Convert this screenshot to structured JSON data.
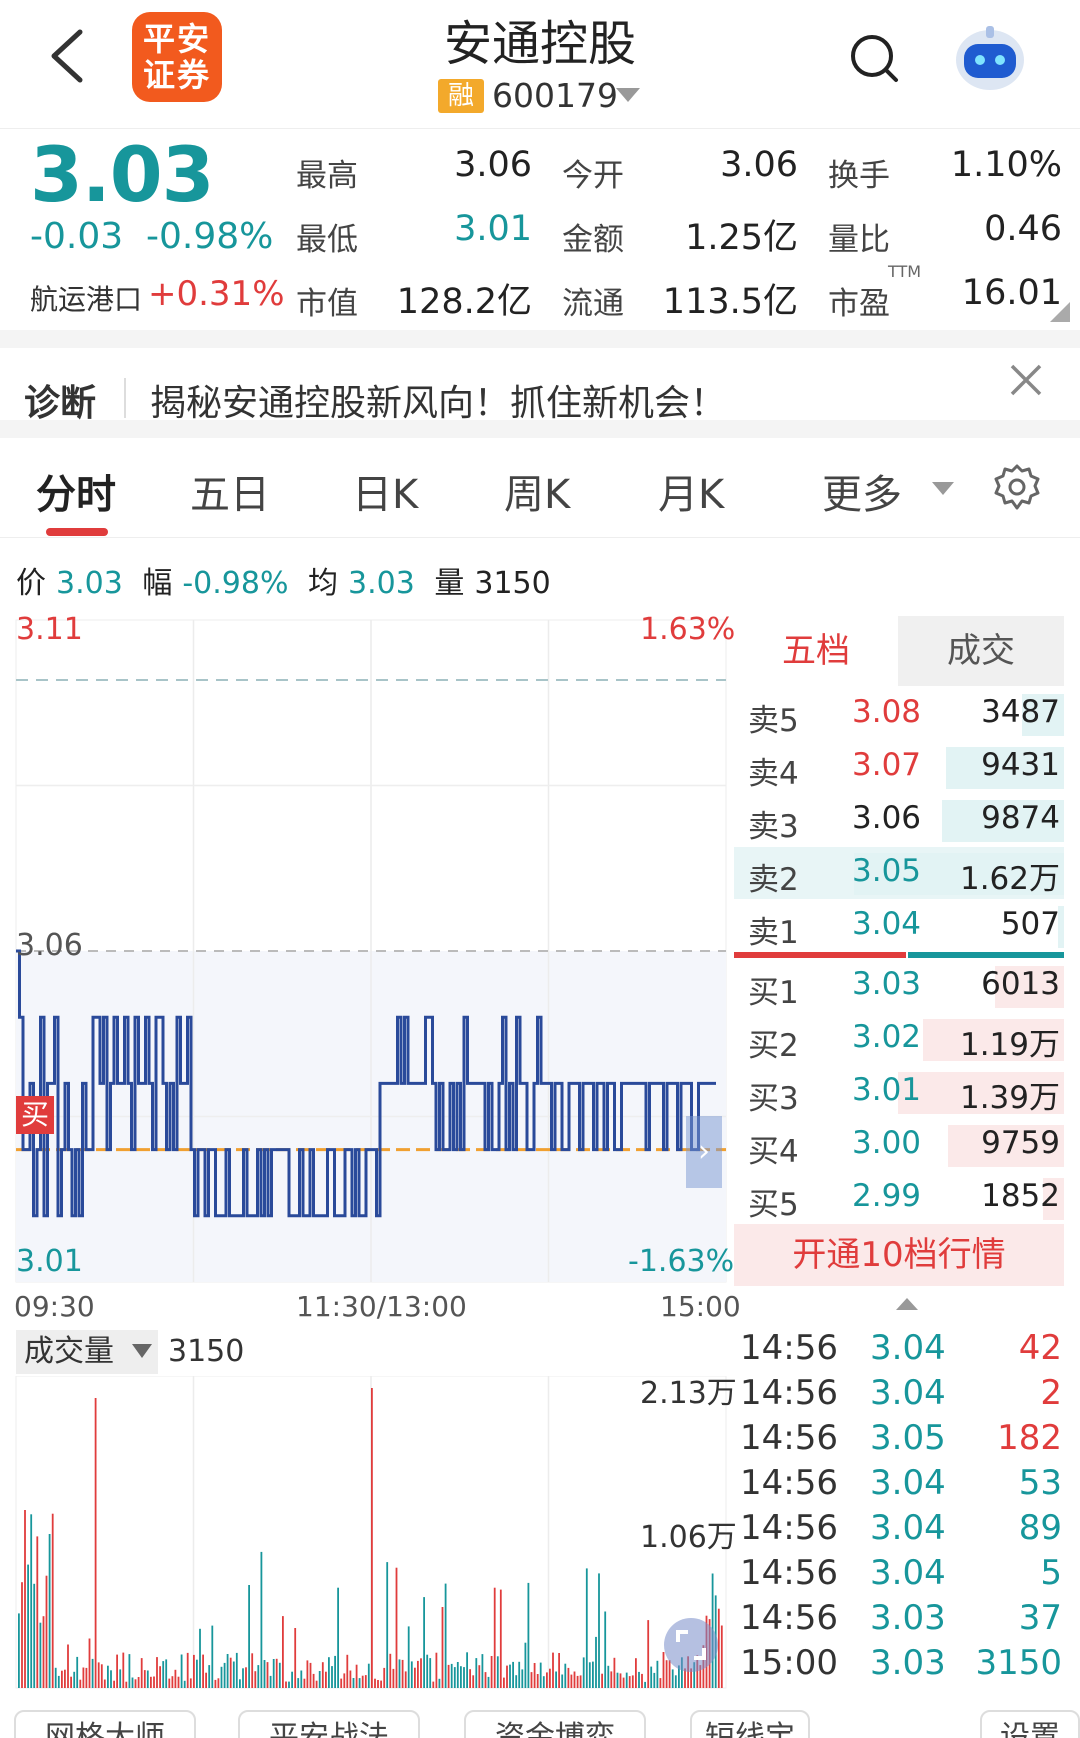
{
  "header": {
    "logo_line1": "平安",
    "logo_line2": "证券",
    "stock_name": "安通控股",
    "badge": "融",
    "stock_code": "600179"
  },
  "quote": {
    "price": "3.03",
    "change": "-0.03",
    "change_pct": "-0.98%",
    "sector_label": "航运港口",
    "sector_change": "+0.31%",
    "items": [
      {
        "label": "最高",
        "value": "3.06"
      },
      {
        "label": "今开",
        "value": "3.06"
      },
      {
        "label": "换手",
        "value": "1.10%"
      },
      {
        "label": "最低",
        "value": "3.01"
      },
      {
        "label": "金额",
        "value": "1.25亿"
      },
      {
        "label": "量比",
        "value": "0.46"
      },
      {
        "label": "市值",
        "value": "128.2亿"
      },
      {
        "label": "流通",
        "value": "113.5亿"
      },
      {
        "label": "市盈",
        "value": "16.01"
      }
    ],
    "ttm": "TTM"
  },
  "diagnosis": {
    "title": "诊断",
    "text": "揭秘安通控股新风向！抓住新机会！"
  },
  "tabs": [
    "分时",
    "五日",
    "日K",
    "周K",
    "月K",
    "更多"
  ],
  "info_row": {
    "price_label": "价",
    "price": "3.03",
    "range_label": "幅",
    "range": "-0.98%",
    "avg_label": "均",
    "avg": "3.03",
    "vol_label": "量",
    "vol": "3150"
  },
  "chart": {
    "y_max": "3.11",
    "y_max_pct": "1.63%",
    "y_ref": "3.06",
    "y_min": "3.01",
    "y_min_pct": "-1.63%",
    "x_start": "09:30",
    "x_mid": "11:30/13:00",
    "x_end": "15:00",
    "buy_marker": "买",
    "colors": {
      "line": "#2a4a9a",
      "avg": "#f0a030",
      "up": "#e03c3c",
      "down": "#17969b"
    }
  },
  "chart_data": {
    "type": "line",
    "ylim": [
      3.01,
      3.11
    ],
    "price_levels": [
      3.06,
      3.05,
      3.04,
      3.03,
      3.02
    ],
    "prev_close": 3.06,
    "avg_price": 3.03
  },
  "order_book": {
    "tab_five": "五档",
    "tab_deals": "成交",
    "asks": [
      {
        "label": "卖5",
        "price": "3.08",
        "vol": "3487",
        "bar": 0.2
      },
      {
        "label": "卖4",
        "price": "3.07",
        "vol": "9431",
        "bar": 0.56
      },
      {
        "label": "卖3",
        "price": "3.06",
        "vol": "9874",
        "bar": 0.58
      },
      {
        "label": "卖2",
        "price": "3.05",
        "vol": "1.62万",
        "bar": 1.0
      },
      {
        "label": "卖1",
        "price": "3.04",
        "vol": "507",
        "bar": 0.03
      }
    ],
    "bids": [
      {
        "label": "买1",
        "price": "3.03",
        "vol": "6013",
        "bar": 0.33
      },
      {
        "label": "买2",
        "price": "3.02",
        "vol": "1.19万",
        "bar": 0.67
      },
      {
        "label": "买3",
        "price": "3.01",
        "vol": "1.39万",
        "bar": 0.79
      },
      {
        "label": "买4",
        "price": "3.00",
        "vol": "9759",
        "bar": 0.55
      },
      {
        "label": "买5",
        "price": "2.99",
        "vol": "1852",
        "bar": 0.1
      }
    ],
    "open10": "开通10档行情"
  },
  "volume": {
    "label": "成交量",
    "value": "3150",
    "max": "2.13万",
    "mid": "1.06万"
  },
  "ticks": [
    {
      "time": "14:56",
      "price": "3.04",
      "vol": "42",
      "side": "up"
    },
    {
      "time": "14:56",
      "price": "3.04",
      "vol": "2",
      "side": "up"
    },
    {
      "time": "14:56",
      "price": "3.05",
      "vol": "182",
      "side": "up"
    },
    {
      "time": "14:56",
      "price": "3.04",
      "vol": "53",
      "side": "down"
    },
    {
      "time": "14:56",
      "price": "3.04",
      "vol": "89",
      "side": "down"
    },
    {
      "time": "14:56",
      "price": "3.04",
      "vol": "5",
      "side": "down"
    },
    {
      "time": "14:56",
      "price": "3.03",
      "vol": "37",
      "side": "down"
    },
    {
      "time": "15:00",
      "price": "3.03",
      "vol": "3150",
      "side": "down"
    }
  ],
  "bottom_buttons": [
    "网格大师",
    "平安战法",
    "资金博弈",
    "短线宝",
    "设置"
  ]
}
